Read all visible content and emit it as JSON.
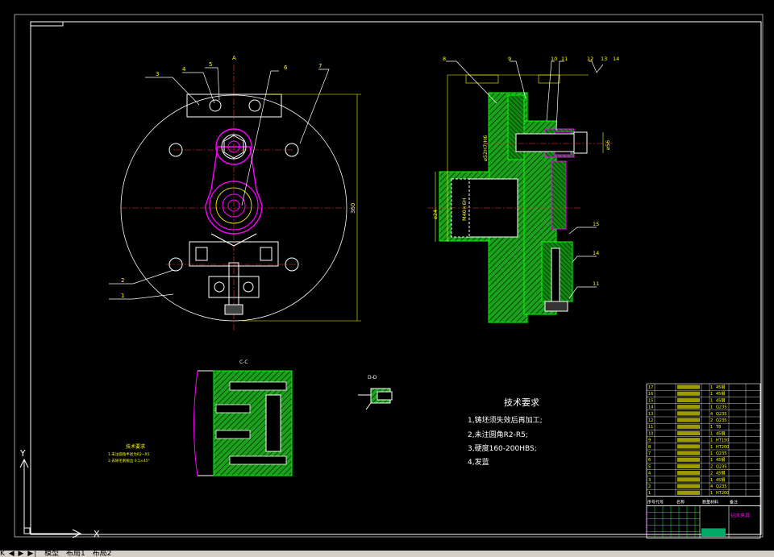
{
  "drawing": {
    "view_labels": {
      "top": "A",
      "section_cc": "C-C",
      "section_dd": "D-D"
    },
    "dimensions": {
      "height": "360",
      "d1": "⌀24",
      "d2": "M40×6H",
      "d3": "⌀52H7/H6",
      "d4": "⌀56"
    },
    "balloons": [
      "1",
      "2",
      "3",
      "4",
      "5",
      "6",
      "7",
      "8",
      "9",
      "10",
      "11",
      "12",
      "13",
      "14",
      "15",
      "14",
      "11"
    ],
    "tech_req_main": {
      "title": "技术要求",
      "items": [
        "1,铸坯须失效后再加工;",
        "2,未注圆角R2-R5;",
        "3,硬度160-200HBS;",
        "4,发蓝"
      ]
    },
    "tech_req_small": {
      "title": "技术要求",
      "items": [
        "1.未注圆角半径为R2~R5",
        "2.去除毛刺锐边 0.5×45°"
      ]
    },
    "bom": {
      "rows": [
        {
          "no": "17",
          "qty": "1",
          "mat": "45钢"
        },
        {
          "no": "16",
          "qty": "1",
          "mat": "45钢"
        },
        {
          "no": "15",
          "qty": "1",
          "mat": "45钢"
        },
        {
          "no": "14",
          "qty": "1",
          "mat": "Q235"
        },
        {
          "no": "13",
          "qty": "4",
          "mat": "Q235"
        },
        {
          "no": "12",
          "qty": "2",
          "mat": "Q235"
        },
        {
          "no": "11",
          "qty": "1",
          "mat": "T8"
        },
        {
          "no": "10",
          "qty": "1",
          "mat": "45钢"
        },
        {
          "no": "9",
          "qty": "1",
          "mat": "HT150"
        },
        {
          "no": "8",
          "qty": "1",
          "mat": "HT200"
        },
        {
          "no": "7",
          "qty": "1",
          "mat": "Q235"
        },
        {
          "no": "6",
          "qty": "1",
          "mat": "45钢"
        },
        {
          "no": "5",
          "qty": "2",
          "mat": "Q235"
        },
        {
          "no": "4",
          "qty": "2",
          "mat": "45钢"
        },
        {
          "no": "3",
          "qty": "1",
          "mat": "45钢"
        },
        {
          "no": "2",
          "qty": "4",
          "mat": "Q235"
        },
        {
          "no": "1",
          "qty": "1",
          "mat": "HT200"
        }
      ],
      "header": [
        "序号",
        "代号",
        "名称",
        "数量",
        "材料",
        "备注"
      ],
      "title_block": "钻床夹具"
    }
  },
  "ui": {
    "nav_arrows": "K ◀ ▶ ▶|",
    "tabs": [
      "模型",
      "布局1",
      "布局2"
    ]
  },
  "colors": {
    "bg": "#000000",
    "frame": "#ffffff",
    "dim": "#ffff00",
    "part": "#00ff00",
    "magenta": "#ff00ff",
    "center": "#ff0000",
    "green": "#00ff00"
  }
}
